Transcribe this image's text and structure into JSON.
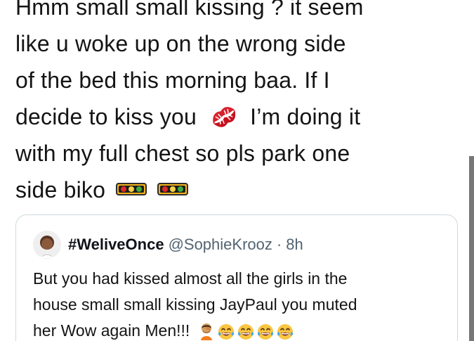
{
  "tweet": {
    "lines": [
      "Hmm small small kissing ? it seem",
      "like u woke up on the wrong side",
      "of the bed this morning baa. If I",
      "decide to kiss you",
      "I’m doing it",
      "with my full chest so pls park one",
      "side biko"
    ],
    "emojis": {
      "kiss_mark": "kiss-mark-icon",
      "traffic_light_1": "horizontal-traffic-light-icon",
      "traffic_light_2": "horizontal-traffic-light-icon"
    }
  },
  "quoted_tweet": {
    "display_name": "#WeliveOnce",
    "handle": "@SophieKrooz",
    "separator": "·",
    "time": "8h",
    "text_lines": [
      "But you had kissed almost all the girls in the",
      "house small small kissing JayPaul you muted",
      "her Wow again Men!!!"
    ],
    "emojis": [
      "person-facepalming-icon",
      "face-with-tears-of-joy-icon",
      "face-with-tears-of-joy-icon",
      "face-with-tears-of-joy-icon",
      "face-with-tears-of-joy-icon"
    ]
  },
  "colors": {
    "text": "#141414",
    "secondary_text": "#536471",
    "border": "#cfd9de",
    "kiss_red": "#d6212d",
    "traffic_yellow": "#f3b21b",
    "traffic_red": "#db2b2b",
    "traffic_green": "#3caa3c",
    "laugh_yellow": "#f8c640",
    "tear_blue": "#47a8ef"
  }
}
